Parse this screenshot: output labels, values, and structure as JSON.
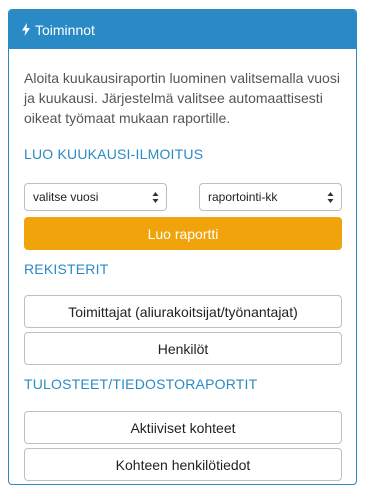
{
  "panel": {
    "title": "Toiminnot",
    "icon": "bolt-icon",
    "accent_color": "#2a8ac6",
    "intro_text": "Aloita kuukausiraportin luominen valitsemalla vuosi ja kuukausi. Järjestelmä valitsee automaattisesti oikeat työmaat mukaan raportille."
  },
  "monthly": {
    "heading": "LUO KUUKAUSI-ILMOITUS",
    "year_select": "valitse vuosi",
    "period_select": "raportointi-kk",
    "create_button": "Luo raportti",
    "create_button_color": "#f0a30a"
  },
  "registers": {
    "heading": "REKISTERIT",
    "buttons": [
      "Toimittajat (aliurakoitsijat/työnantajat)",
      "Henkilöt"
    ]
  },
  "reports": {
    "heading": "TULOSTEET/TIEDOSTORAPORTIT",
    "buttons": [
      "Aktiiviset kohteet",
      "Kohteen henkilötiedot"
    ]
  }
}
